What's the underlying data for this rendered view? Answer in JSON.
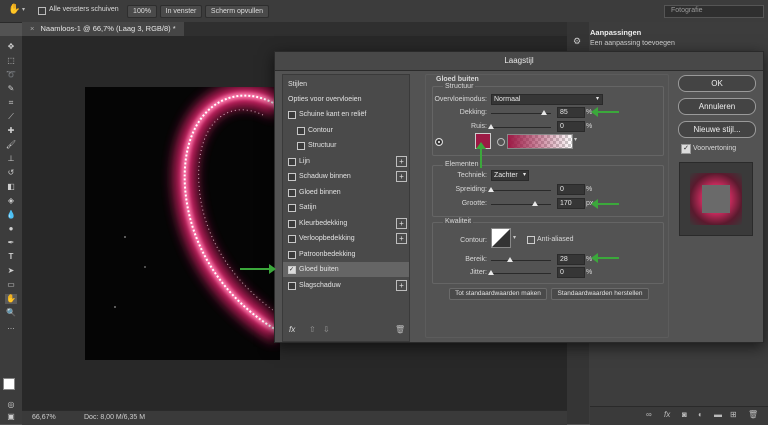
{
  "optionsbar": {
    "scroll_all_label": "Alle vensters schuiven",
    "zoom_btn": "100%",
    "fit_btn": "In venster",
    "fill_btn": "Scherm opvullen",
    "workspace": "Fotografie"
  },
  "document": {
    "tab_title": "Naamloos-1 @ 66,7% (Laag 3, RGB/8) *",
    "status_zoom": "66,67%",
    "status_doc": "Doc: 8,00 M/6,35 M"
  },
  "adjustments": {
    "title": "Aanpassingen",
    "subtitle": "Een aanpassing toevoegen"
  },
  "dialog": {
    "title": "Laagstijl",
    "styles_header": "Stijlen",
    "blend_options": "Opties voor overvloeien",
    "items": [
      {
        "label": "Schuine kant en reliëf",
        "checked": false,
        "plus": false
      },
      {
        "label": "Contour",
        "checked": false,
        "plus": false
      },
      {
        "label": "Structuur",
        "checked": false,
        "plus": false
      },
      {
        "label": "Lijn",
        "checked": false,
        "plus": true
      },
      {
        "label": "Schaduw binnen",
        "checked": false,
        "plus": true
      },
      {
        "label": "Gloed binnen",
        "checked": false,
        "plus": false
      },
      {
        "label": "Satijn",
        "checked": false,
        "plus": false
      },
      {
        "label": "Kleurbedekking",
        "checked": false,
        "plus": true
      },
      {
        "label": "Verloopbedekking",
        "checked": false,
        "plus": true
      },
      {
        "label": "Patroonbedekking",
        "checked": false,
        "plus": false
      },
      {
        "label": "Gloed buiten",
        "checked": true,
        "plus": false
      },
      {
        "label": "Slagschaduw",
        "checked": false,
        "plus": true
      }
    ],
    "fx_label": "fx",
    "section_title": "Gloed buiten",
    "structure_title": "Structuur",
    "blend_mode_label": "Overvloeimodus:",
    "blend_mode_value": "Normaal",
    "opacity_label": "Dekking:",
    "opacity_value": "85",
    "noise_label": "Ruis:",
    "noise_value": "0",
    "elements_title": "Elementen",
    "technique_label": "Techniek:",
    "technique_value": "Zachter",
    "spread_label": "Spreiding:",
    "spread_value": "0",
    "size_label": "Grootte:",
    "size_value": "170",
    "size_unit": "px",
    "quality_title": "Kwaliteit",
    "contour_label": "Contour:",
    "anti_aliased_label": "Anti-aliased",
    "range_label": "Bereik:",
    "range_value": "28",
    "jitter_label": "Jitter:",
    "jitter_value": "0",
    "percent": "%",
    "make_default_btn": "Tot standaardwaarden maken",
    "reset_default_btn": "Standaardwaarden herstellen",
    "ok_btn": "OK",
    "cancel_btn": "Annuleren",
    "new_style_btn": "Nieuwe stijl...",
    "preview_label": "Voorvertoning",
    "glow_color": "#9c1a45"
  }
}
